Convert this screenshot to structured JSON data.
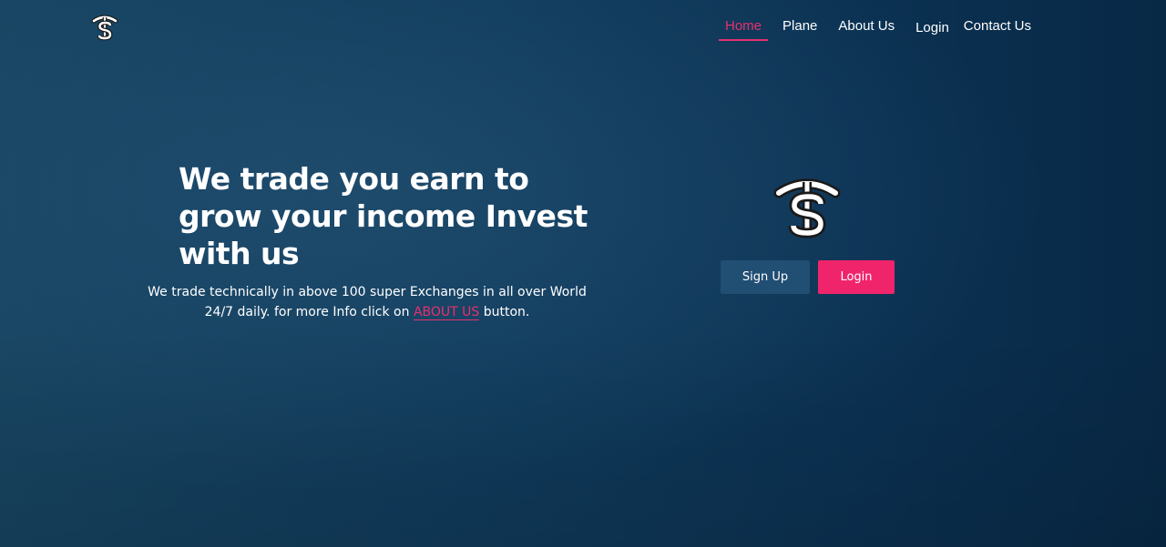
{
  "brand": {
    "logo_icon": "ts-dollar-logo-icon"
  },
  "nav": {
    "items": [
      {
        "label": "Home",
        "active": true
      },
      {
        "label": "Plane",
        "active": false
      },
      {
        "label": "About Us",
        "active": false
      },
      {
        "label": "Login",
        "active": false
      },
      {
        "label": "Contact Us",
        "active": false
      }
    ]
  },
  "hero": {
    "title": "We trade you earn to grow your income Invest with us",
    "desc_before": "We trade technically in above 100 super Exchanges in all over World 24/7 daily. for more Info click on ",
    "desc_link": "ABOUT US",
    "desc_after": " button."
  },
  "actions": {
    "signup_label": "Sign Up",
    "login_label": "Login"
  },
  "colors": {
    "accent": "#f0246b",
    "nav_active": "#e8306e",
    "secondary_button": "#214e73",
    "background": "#0f3a5b"
  }
}
